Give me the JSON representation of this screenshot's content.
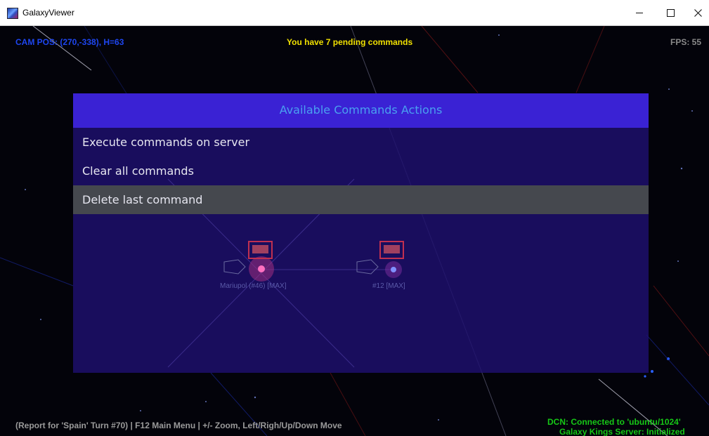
{
  "window": {
    "title": "GalaxyViewer"
  },
  "hud": {
    "cam_pos": "CAM POS: (270,-338), H=63",
    "pending": "You have 7 pending commands",
    "fps": "FPS: 55",
    "status_bar": "(Report for 'Spain' Turn #70) | F12 Main Menu | +/- Zoom, Left/Righ/Up/Down Move",
    "dcn": "DCN: Connected to 'ubuntu/1024'",
    "server": "Galaxy Kings Server: Initialized"
  },
  "dialog": {
    "title": "Available Commands Actions",
    "items": [
      {
        "label": "Execute commands on server",
        "selected": false
      },
      {
        "label": "Clear all commands",
        "selected": false
      },
      {
        "label": "Delete last command",
        "selected": true
      }
    ]
  },
  "planets": [
    {
      "label": "Mariupol (#46) [MAX]"
    },
    {
      "label": "#12 [MAX]"
    }
  ],
  "colors": {
    "cam_pos": "#1e46f0",
    "pending": "#f0e000",
    "connected": "#16c816",
    "dialog_header": "#3a22d4",
    "dialog_title": "#4aa0f0",
    "selected_item": "#45484e"
  }
}
